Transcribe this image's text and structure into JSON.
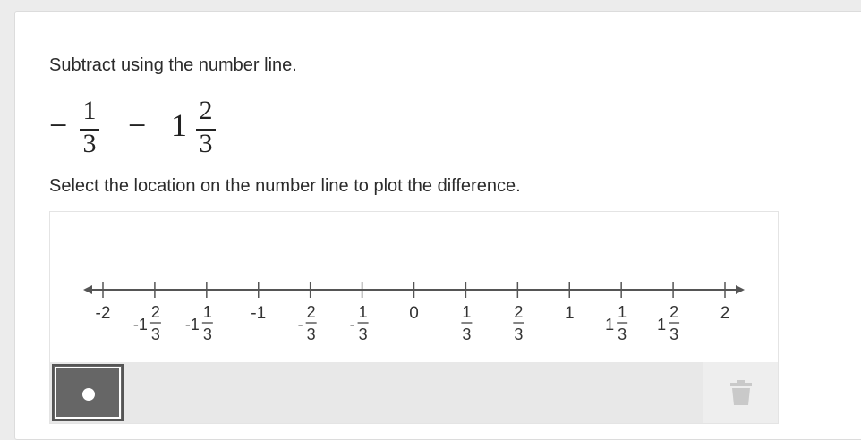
{
  "question": {
    "prompt": "Subtract using the number line.",
    "expression": {
      "lead_sign": "−",
      "frac1": {
        "num": "1",
        "den": "3"
      },
      "operator": "−",
      "whole2": "1",
      "frac2": {
        "num": "2",
        "den": "3"
      }
    },
    "instruction": "Select the location on the number line to plot the difference."
  },
  "number_line": {
    "min": -2,
    "max": 2,
    "step": "1/3",
    "labels": [
      {
        "value": -2,
        "whole": "-2",
        "num": "",
        "den": ""
      },
      {
        "value": -1.6667,
        "whole": "-1",
        "num": "2",
        "den": "3"
      },
      {
        "value": -1.3333,
        "whole": "-1",
        "num": "1",
        "den": "3"
      },
      {
        "value": -1,
        "whole": "-1",
        "num": "",
        "den": ""
      },
      {
        "value": -0.6667,
        "whole": "-",
        "num": "2",
        "den": "3"
      },
      {
        "value": -0.3333,
        "whole": "-",
        "num": "1",
        "den": "3"
      },
      {
        "value": 0,
        "whole": "0",
        "num": "",
        "den": ""
      },
      {
        "value": 0.3333,
        "whole": "",
        "num": "1",
        "den": "3"
      },
      {
        "value": 0.6667,
        "whole": "",
        "num": "2",
        "den": "3"
      },
      {
        "value": 1,
        "whole": "1",
        "num": "",
        "den": ""
      },
      {
        "value": 1.3333,
        "whole": "1",
        "num": "1",
        "den": "3"
      },
      {
        "value": 1.6667,
        "whole": "1",
        "num": "2",
        "den": "3"
      },
      {
        "value": 2,
        "whole": "2",
        "num": "",
        "den": ""
      }
    ]
  },
  "toolbar": {
    "point_tool_icon": "point-icon",
    "delete_tool_icon": "trash-icon"
  },
  "colors": {
    "axis": "#555555",
    "tool_selected": "#666666",
    "toolbar_bg": "#e8e8e8",
    "delete_icon": "#c9c9c9"
  }
}
